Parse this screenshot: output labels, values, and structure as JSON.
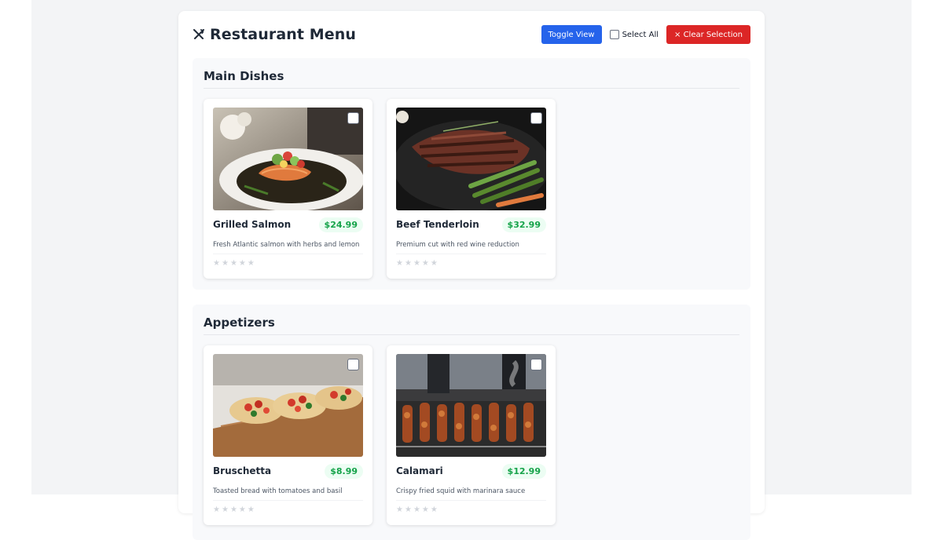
{
  "header": {
    "title": "Restaurant Menu",
    "title_icon": "fork-knife-icon",
    "toggle_label": "Toggle View",
    "select_all_label": "Select All",
    "clear_label": "× Clear Selection"
  },
  "sections": [
    {
      "title": "Main Dishes",
      "items": [
        {
          "name": "Grilled Salmon",
          "price": "$24.99",
          "description": "Fresh Atlantic salmon with herbs and lemon",
          "rating": 0,
          "image": "salmon-photo"
        },
        {
          "name": "Beef Tenderloin",
          "price": "$32.99",
          "description": "Premium cut with red wine reduction",
          "rating": 0,
          "image": "steak-photo"
        }
      ]
    },
    {
      "title": "Appetizers",
      "items": [
        {
          "name": "Bruschetta",
          "price": "$8.99",
          "description": "Toasted bread with tomatoes and basil",
          "rating": 0,
          "image": "bruschetta-photo"
        },
        {
          "name": "Calamari",
          "price": "$12.99",
          "description": "Crispy fried squid with marinara sauce",
          "rating": 0,
          "image": "skewers-photo"
        }
      ]
    }
  ],
  "colors": {
    "primary": "#2563eb",
    "danger": "#dc2626",
    "price_text": "#16a34a",
    "price_bg": "#ecfdf3"
  }
}
